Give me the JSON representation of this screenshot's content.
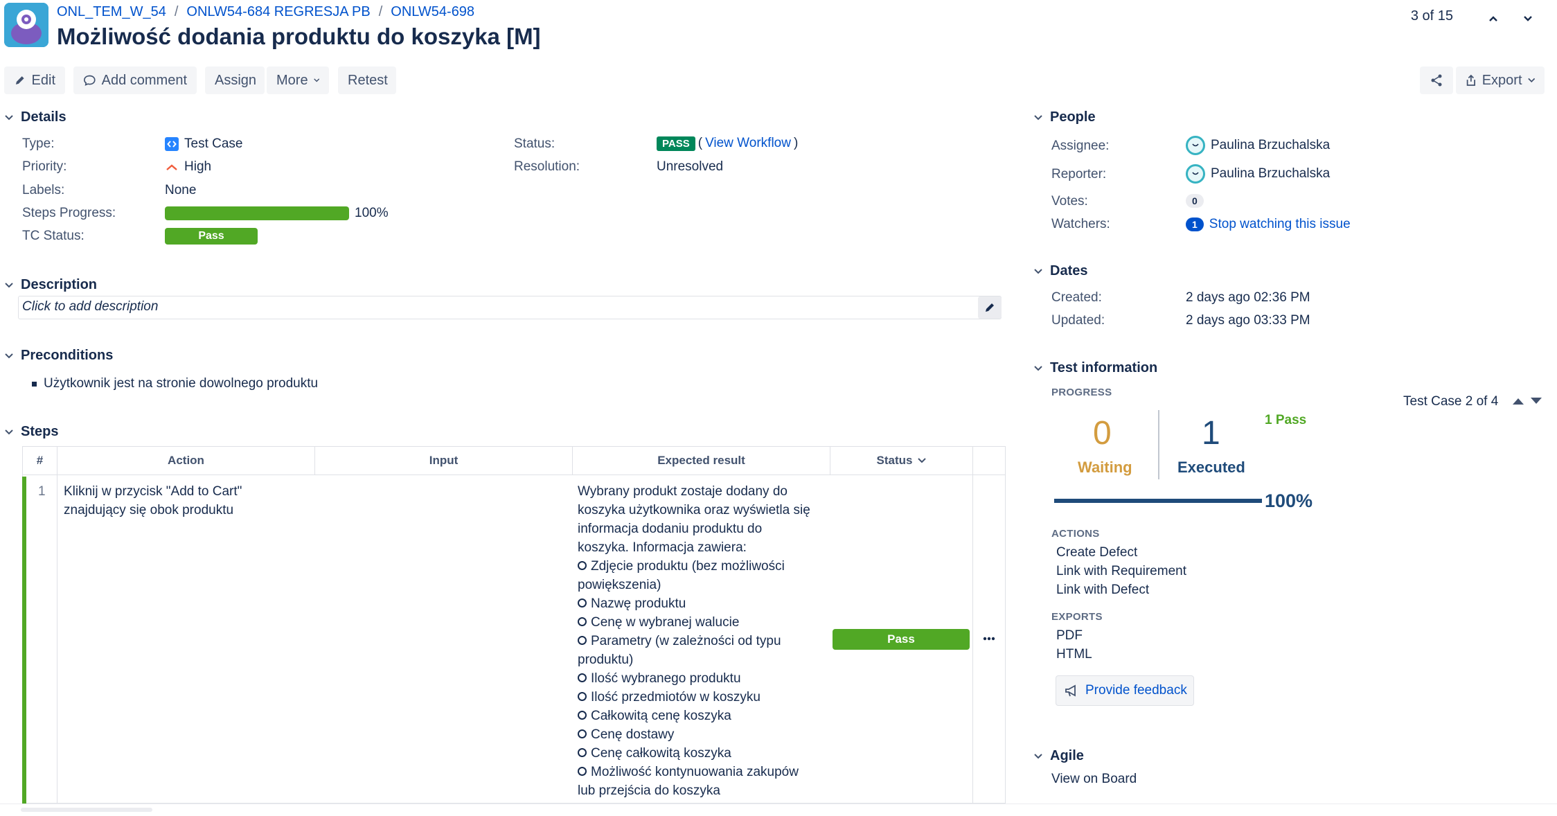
{
  "breadcrumbs": [
    "ONL_TEM_W_54",
    "ONLW54-684 REGRESJA PB",
    "ONLW54-698"
  ],
  "issue_title": "Możliwość dodania produktu do koszyka [M]",
  "pager": {
    "text": "3 of 15"
  },
  "toolbar": {
    "edit": "Edit",
    "add_comment": "Add comment",
    "assign": "Assign",
    "more": "More",
    "retest": "Retest",
    "export": "Export"
  },
  "details": {
    "heading": "Details",
    "type_label": "Type:",
    "type_value": "Test Case",
    "priority_label": "Priority:",
    "priority_value": "High",
    "labels_label": "Labels:",
    "labels_value": "None",
    "steps_progress_label": "Steps Progress:",
    "steps_progress_value": "100%",
    "steps_progress_fraction": 1.0,
    "tc_status_label": "TC Status:",
    "tc_status_value": "Pass",
    "status_label": "Status:",
    "status_value": "PASS",
    "view_workflow": "View Workflow",
    "resolution_label": "Resolution:",
    "resolution_value": "Unresolved"
  },
  "description": {
    "heading": "Description",
    "placeholder": "Click to add description"
  },
  "preconditions": {
    "heading": "Preconditions",
    "items": [
      "Użytkownik jest na stronie dowolnego produktu"
    ]
  },
  "steps": {
    "heading": "Steps",
    "columns": [
      "#",
      "Action",
      "Input",
      "Expected result",
      "Status"
    ],
    "rows": [
      {
        "number": "1",
        "action_lines": [
          "Kliknij w przycisk \"Add to Cart\"",
          "znajdujący się obok produktu"
        ],
        "input": "",
        "expected_intro": [
          "Wybrany produkt zostaje dodany do",
          "koszyka użytkownika oraz wyświetla się",
          "informacja dodaniu produktu do",
          "koszyka. Informacja zawiera:"
        ],
        "expected_items": [
          [
            "Zdjęcie produktu (bez możliwości",
            "powiększenia)"
          ],
          [
            "Nazwę produktu"
          ],
          [
            "Cenę w wybranej walucie"
          ],
          [
            "Parametry (w zależności od typu",
            "produktu)"
          ],
          [
            "Ilość wybranego produktu"
          ],
          [
            "Ilość przedmiotów w koszyku"
          ],
          [
            "Całkowitą cenę koszyka"
          ],
          [
            "Cenę dostawy"
          ],
          [
            "Cenę całkowitą koszyka"
          ],
          [
            "Możliwość kontynuowania zakupów",
            "lub przejścia do koszyka"
          ]
        ],
        "status": "Pass"
      }
    ]
  },
  "people": {
    "heading": "People",
    "assignee_label": "Assignee:",
    "assignee": "Paulina Brzuchalska",
    "reporter_label": "Reporter:",
    "reporter": "Paulina Brzuchalska",
    "votes_label": "Votes:",
    "votes": "0",
    "watchers_label": "Watchers:",
    "watchers": "1",
    "watch_link": "Stop watching this issue"
  },
  "dates": {
    "heading": "Dates",
    "created_label": "Created:",
    "created": "2 days ago 02:36 PM",
    "updated_label": "Updated:",
    "updated": "2 days ago 03:33 PM"
  },
  "test_info": {
    "heading": "Test information",
    "progress_label": "PROGRESS",
    "nav": "Test Case 2 of 4",
    "waiting_count": "0",
    "waiting_label": "Waiting",
    "executed_count": "1",
    "executed_label": "Executed",
    "pass_summary": "1 Pass",
    "percent": "100%",
    "percent_fraction": 1.0,
    "actions_label": "ACTIONS",
    "actions": [
      "Create Defect",
      "Link with Requirement",
      "Link with Defect"
    ],
    "exports_label": "EXPORTS",
    "exports": [
      "PDF",
      "HTML"
    ],
    "feedback": "Provide feedback"
  },
  "agile": {
    "heading": "Agile",
    "link": "View on Board"
  },
  "colors": {
    "pass_green": "#51a825",
    "status_green": "#00875a",
    "link_blue": "#0052cc",
    "waiting_orange": "#d39c3f",
    "executed_navy": "#1f4b7a"
  },
  "icons": [
    "app-logo-icon",
    "pencil-icon",
    "comment-icon",
    "chevron-down-icon",
    "share-icon",
    "export-icon",
    "test-case-icon",
    "priority-high-icon",
    "megaphone-icon",
    "more-icon"
  ]
}
